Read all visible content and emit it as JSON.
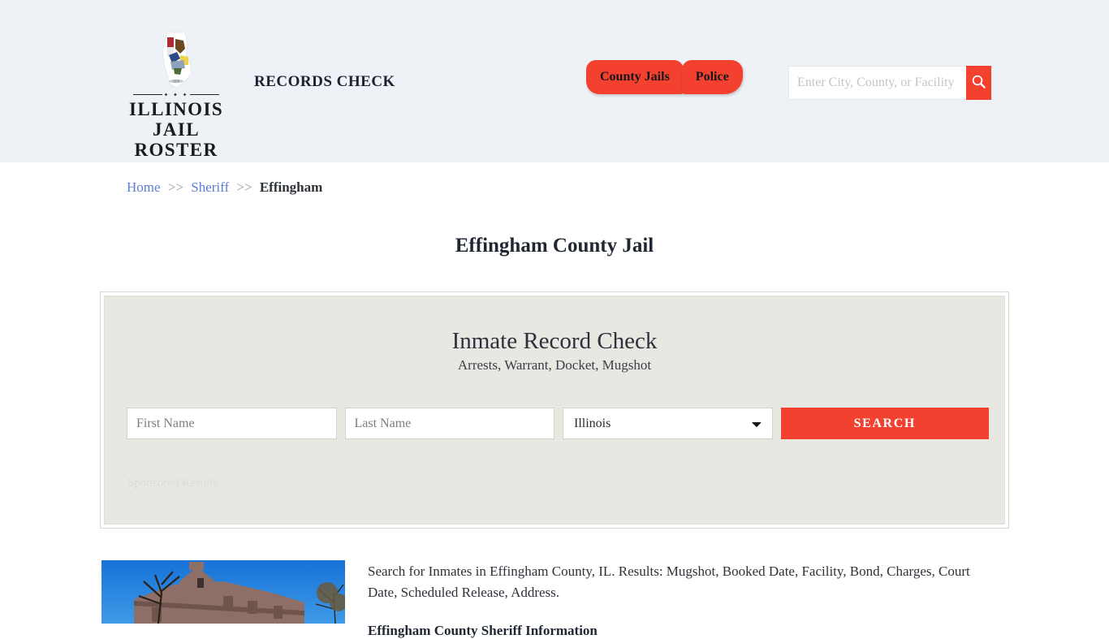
{
  "header": {
    "logo": {
      "icon": "illinois-state-outline-seal",
      "line1": "ILLINOIS",
      "line2": "JAIL ROSTER",
      "divider_dots": "✦ ✦ ✦"
    },
    "tagline": "RECORDS CHECK",
    "nav": [
      {
        "label": "County Jails"
      },
      {
        "label": "Police"
      }
    ],
    "search": {
      "placeholder": "Enter City, County, or Facility",
      "value": "",
      "button_icon": "search-icon"
    },
    "background_color": "#eef2f7"
  },
  "breadcrumb": {
    "items": [
      {
        "label": "Home",
        "type": "link"
      },
      {
        "label": "Sheriff",
        "type": "link"
      },
      {
        "label": "Effingham",
        "type": "current"
      }
    ],
    "separator": ">>"
  },
  "page": {
    "title": "Effingham County Jail"
  },
  "record_check_panel": {
    "title": "Inmate Record Check",
    "subtitle": "Arrests, Warrant, Docket, Mugshot",
    "form": {
      "first_name": {
        "placeholder": "First Name",
        "value": ""
      },
      "last_name": {
        "placeholder": "Last Name",
        "value": ""
      },
      "state": {
        "selected": "Illinois",
        "options": [
          "Illinois"
        ]
      },
      "submit_label": "SEARCH"
    },
    "sponsored_label": "Sponsored Results",
    "accent_color": "#f24130",
    "panel_color": "#e8e7e1"
  },
  "content": {
    "photo_alt": "effingham-county-courthouse-photo",
    "paragraph": "Search for Inmates in Effingham County, IL. Results: Mugshot, Booked Date, Facility, Bond, Charges, Court Date, Scheduled Release, Address.",
    "section_heading": "Effingham County Sheriff Information"
  }
}
